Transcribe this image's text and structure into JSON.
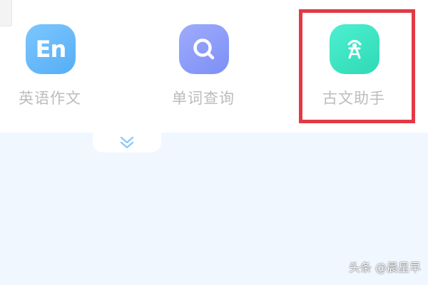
{
  "tools": [
    {
      "label": "英语作文",
      "icon": "english-letters-icon",
      "icon_text": "En",
      "color": "#67b9fb"
    },
    {
      "label": "单词查询",
      "icon": "search-icon",
      "color": "#8d9cf9"
    },
    {
      "label": "古文助手",
      "icon": "classical-chinese-figure-icon",
      "color": "#3ee6c6",
      "highlighted": true
    }
  ],
  "expand_icon": "double-chevron-down-icon",
  "highlight_color": "#e23a44",
  "watermark": "头条 @晨星早"
}
